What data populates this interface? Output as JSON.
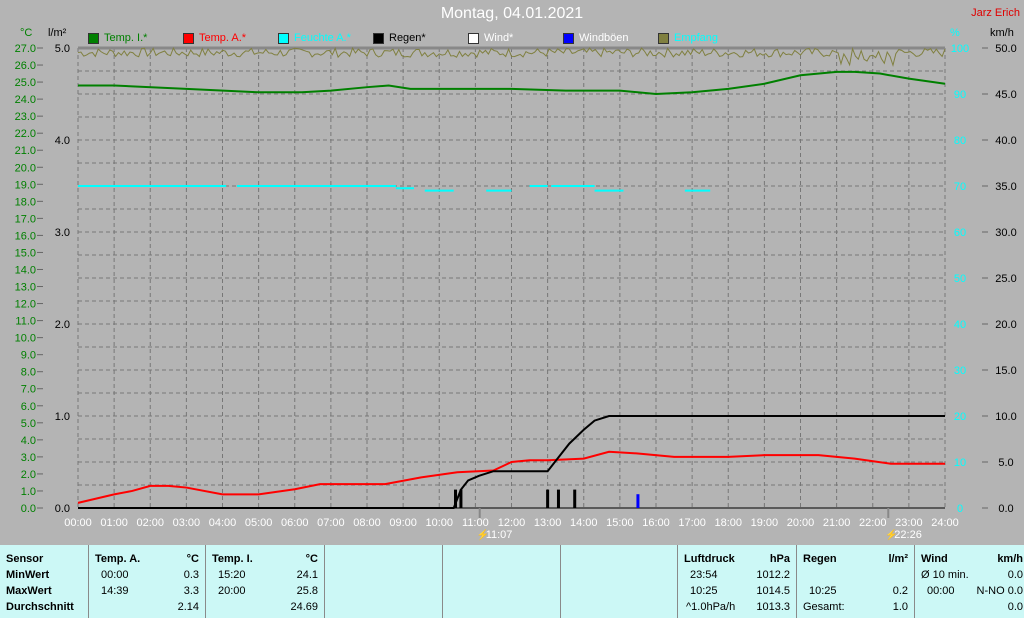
{
  "title": "Montag, 04.01.2021",
  "author": "Jarz Erich",
  "units": {
    "temp": "°C",
    "rain": "l/m²",
    "hum": "%",
    "wind": "km/h"
  },
  "legend": [
    {
      "label": "Temp. I.*",
      "color": "#008000"
    },
    {
      "label": "Temp. A.*",
      "color": "#ff0000"
    },
    {
      "label": "Feuchte A.*",
      "color": "#00ffff"
    },
    {
      "label": "Regen*",
      "color": "#000000"
    },
    {
      "label": "Wind*",
      "color": "#ffffff"
    },
    {
      "label": "Windböen",
      "color": "#0000ff"
    },
    {
      "label": "Empfang",
      "color": "#808040"
    }
  ],
  "markers": [
    {
      "time": "11:07",
      "hour": 11.12
    },
    {
      "time": "22:26",
      "hour": 22.43
    }
  ],
  "chart_data": {
    "type": "line",
    "x_ticks": [
      "00:00",
      "01:00",
      "02:00",
      "03:00",
      "04:00",
      "05:00",
      "06:00",
      "07:00",
      "08:00",
      "09:00",
      "10:00",
      "11:00",
      "12:00",
      "13:00",
      "14:00",
      "15:00",
      "16:00",
      "17:00",
      "18:00",
      "19:00",
      "20:00",
      "21:00",
      "22:00",
      "23:00",
      "24:00"
    ],
    "axes": {
      "temp_c": [
        0,
        27
      ],
      "rain_lm2": [
        0,
        5
      ],
      "humidity_pct": [
        0,
        100
      ],
      "wind_kmh": [
        0,
        50
      ]
    },
    "series": [
      {
        "name": "Temp. I.*",
        "axis": "temp_c",
        "color": "#008000",
        "points": [
          [
            0,
            24.8
          ],
          [
            1,
            24.8
          ],
          [
            3,
            24.6
          ],
          [
            5,
            24.4
          ],
          [
            6.2,
            24.4
          ],
          [
            7,
            24.5
          ],
          [
            8,
            24.7
          ],
          [
            8.6,
            24.8
          ],
          [
            9.2,
            24.6
          ],
          [
            10,
            24.6
          ],
          [
            12,
            24.6
          ],
          [
            13.5,
            24.5
          ],
          [
            15,
            24.5
          ],
          [
            16,
            24.3
          ],
          [
            17,
            24.4
          ],
          [
            18,
            24.6
          ],
          [
            19,
            24.9
          ],
          [
            20,
            25.4
          ],
          [
            21,
            25.6
          ],
          [
            21.5,
            25.6
          ],
          [
            22.2,
            25.5
          ],
          [
            23,
            25.2
          ],
          [
            24,
            24.9
          ]
        ]
      },
      {
        "name": "Temp. A.*",
        "axis": "temp_c",
        "color": "#ff0000",
        "points": [
          [
            0,
            0.3
          ],
          [
            1,
            0.8
          ],
          [
            1.5,
            1.0
          ],
          [
            2,
            1.3
          ],
          [
            2.5,
            1.3
          ],
          [
            3,
            1.2
          ],
          [
            4,
            0.8
          ],
          [
            5,
            0.8
          ],
          [
            6,
            1.1
          ],
          [
            6.7,
            1.4
          ],
          [
            8.5,
            1.4
          ],
          [
            9.5,
            1.8
          ],
          [
            10.5,
            2.1
          ],
          [
            11.5,
            2.2
          ],
          [
            12,
            2.7
          ],
          [
            12.5,
            2.8
          ],
          [
            13,
            2.8
          ],
          [
            14,
            2.9
          ],
          [
            14.7,
            3.3
          ],
          [
            15.5,
            3.2
          ],
          [
            16.5,
            3.0
          ],
          [
            18,
            3.0
          ],
          [
            19,
            3.1
          ],
          [
            20.5,
            3.1
          ],
          [
            21.5,
            2.9
          ],
          [
            22.5,
            2.6
          ],
          [
            24,
            2.6
          ]
        ]
      },
      {
        "name": "Regen*",
        "axis": "rain_lm2",
        "color": "#000000",
        "points": [
          [
            0,
            0
          ],
          [
            10.4,
            0
          ],
          [
            10.6,
            0.2
          ],
          [
            10.8,
            0.3
          ],
          [
            11.1,
            0.35
          ],
          [
            11.5,
            0.4
          ],
          [
            13,
            0.4
          ],
          [
            13.3,
            0.55
          ],
          [
            13.6,
            0.7
          ],
          [
            14,
            0.85
          ],
          [
            14.3,
            0.95
          ],
          [
            14.7,
            1.0
          ],
          [
            24,
            1.0
          ]
        ]
      },
      {
        "name": "Regen bars",
        "axis": "rain_lm2",
        "color": "#000000",
        "bars": [
          [
            10.45,
            0.2
          ],
          [
            10.6,
            0.2
          ],
          [
            13.0,
            0.2
          ],
          [
            13.3,
            0.2
          ],
          [
            13.75,
            0.2
          ]
        ]
      },
      {
        "name": "Feuchte A.*",
        "axis": "humidity_pct",
        "color": "#00ffff",
        "segments": [
          [
            0,
            4.1,
            70
          ],
          [
            4.4,
            8.8,
            70
          ],
          [
            8.8,
            9.3,
            69.5
          ],
          [
            9.6,
            10.4,
            69
          ],
          [
            11.3,
            12.0,
            69
          ],
          [
            12.5,
            13.0,
            70
          ],
          [
            13.1,
            14.3,
            70
          ],
          [
            14.3,
            15.1,
            69
          ],
          [
            16.8,
            17.5,
            69
          ]
        ]
      },
      {
        "name": "Windböen",
        "axis": "wind_kmh",
        "color": "#0000ff",
        "bars": [
          [
            15.5,
            1.5
          ]
        ]
      },
      {
        "name": "Empfang",
        "axis": "humidity_pct",
        "color": "#808040",
        "noise": [
          96,
          100
        ]
      }
    ]
  },
  "table": {
    "sensor": {
      "header": "Sensor",
      "rows": [
        "MinWert",
        "MaxWert",
        "Durchschnitt"
      ]
    },
    "temp_a": {
      "header": "Temp. A.",
      "unit": "°C",
      "min_time": "00:00",
      "min": "0.3",
      "max_time": "14:39",
      "max": "3.3",
      "avg": "2.14"
    },
    "temp_i": {
      "header": "Temp. I.",
      "unit": "°C",
      "min_time": "15:20",
      "min": "24.1",
      "max_time": "20:00",
      "max": "25.8",
      "avg": "24.69"
    },
    "pressure": {
      "header": "Luftdruck",
      "unit": "hPa",
      "min_time": "23:54",
      "min": "1012.2",
      "max_time": "10:25",
      "max": "1014.5",
      "trend_label": "^1.0hPa/h",
      "avg": "1013.3"
    },
    "rain": {
      "header": "Regen",
      "unit": "l/m²",
      "max_time": "10:25",
      "max": "0.2",
      "total_label": "Gesamt:",
      "total": "1.0"
    },
    "wind": {
      "header": "Wind",
      "unit": "km/h",
      "min_label": "Ø 10 min.",
      "min": "0.0",
      "max_time": "00:00",
      "max": "N-NO 0.0",
      "avg": "0.0"
    }
  }
}
